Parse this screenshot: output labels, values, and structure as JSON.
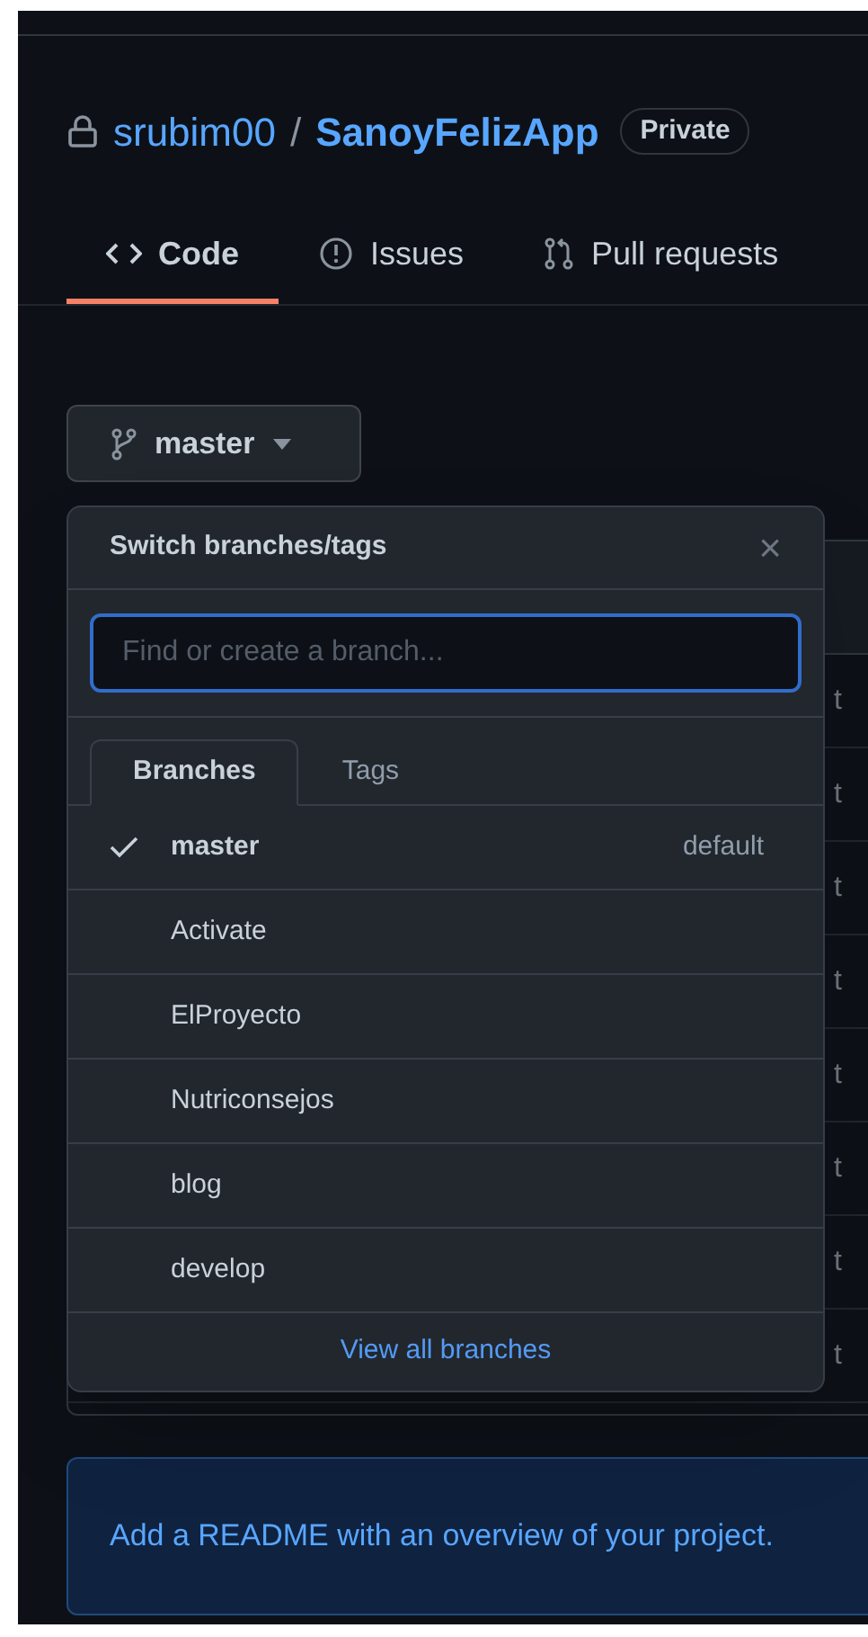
{
  "repo": {
    "owner": "srubim00",
    "separator": "/",
    "name": "SanoyFelizApp",
    "visibility": "Private"
  },
  "tabs": [
    {
      "label": "Code",
      "selected": true
    },
    {
      "label": "Issues",
      "selected": false
    },
    {
      "label": "Pull requests",
      "selected": false
    }
  ],
  "branch_button": {
    "label": "master"
  },
  "file_rows": [
    {
      "text": "t"
    },
    {
      "text": "t"
    },
    {
      "text": "t"
    },
    {
      "text": "t"
    },
    {
      "text": "t"
    },
    {
      "text": "t"
    },
    {
      "text": "t"
    },
    {
      "text": "t"
    }
  ],
  "branch_menu": {
    "title": "Switch branches/tags",
    "close": "×",
    "search": {
      "placeholder": "Find or create a branch..."
    },
    "tabs": [
      {
        "label": "Branches",
        "selected": true
      },
      {
        "label": "Tags",
        "selected": false
      }
    ],
    "branches": [
      {
        "name": "master",
        "selected": true,
        "badge": "default"
      },
      {
        "name": "Activate",
        "selected": false
      },
      {
        "name": "ElProyecto",
        "selected": false
      },
      {
        "name": "Nutriconsejos",
        "selected": false
      },
      {
        "name": "blog",
        "selected": false
      },
      {
        "name": "develop",
        "selected": false
      }
    ],
    "footer_link": "View all branches"
  },
  "readme_banner": "Add a README with an overview of your project."
}
